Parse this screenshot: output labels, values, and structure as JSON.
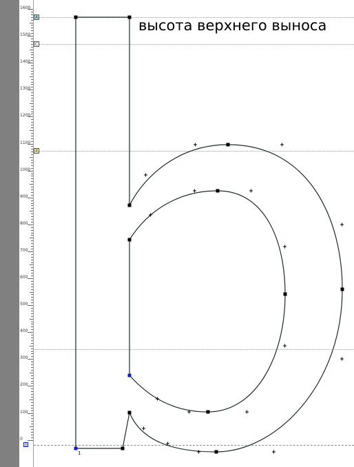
{
  "caption": "высота верхнего выноса",
  "ruler": {
    "labels": [
      "1600",
      "1500",
      "1400",
      "1300",
      "1200",
      "1100",
      "1000",
      "900",
      "800",
      "700",
      "600",
      "500",
      "400",
      "300",
      "200",
      "100",
      "0"
    ]
  },
  "guides": {
    "markers": [
      "A",
      "C",
      "X"
    ],
    "origin_marker": "0"
  },
  "point_label": "1",
  "colors": {
    "outline": "#1a2a2a",
    "ruler_background": "#ffffff",
    "side_strip": "#808080",
    "marker_cyan": "#a8e0e8",
    "marker_yellow": "#f0f0a0",
    "anchor_selected": "#1020c0"
  }
}
